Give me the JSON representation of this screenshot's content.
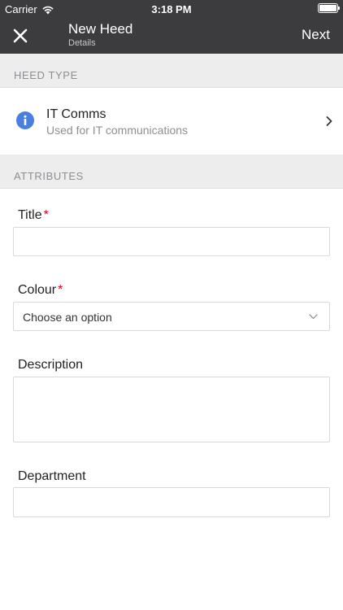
{
  "status_bar": {
    "carrier": "Carrier",
    "time": "3:18 PM"
  },
  "nav": {
    "title": "New Heed",
    "subtitle": "Details",
    "next_label": "Next"
  },
  "sections": {
    "heed_type": "HEED TYPE",
    "attributes": "ATTRIBUTES"
  },
  "heed_type": {
    "name": "IT Comms",
    "description": "Used for IT communications",
    "icon": "info-icon",
    "icon_color": "#4a7fe0"
  },
  "form": {
    "title": {
      "label": "Title",
      "required_mark": "*",
      "value": ""
    },
    "colour": {
      "label": "Colour",
      "required_mark": "*",
      "selected": "Choose an option"
    },
    "description": {
      "label": "Description",
      "value": ""
    },
    "department": {
      "label": "Department",
      "value": ""
    }
  },
  "colors": {
    "bar": "#3c3c3e",
    "section_bg": "#ededed",
    "required": "#d0021b"
  }
}
